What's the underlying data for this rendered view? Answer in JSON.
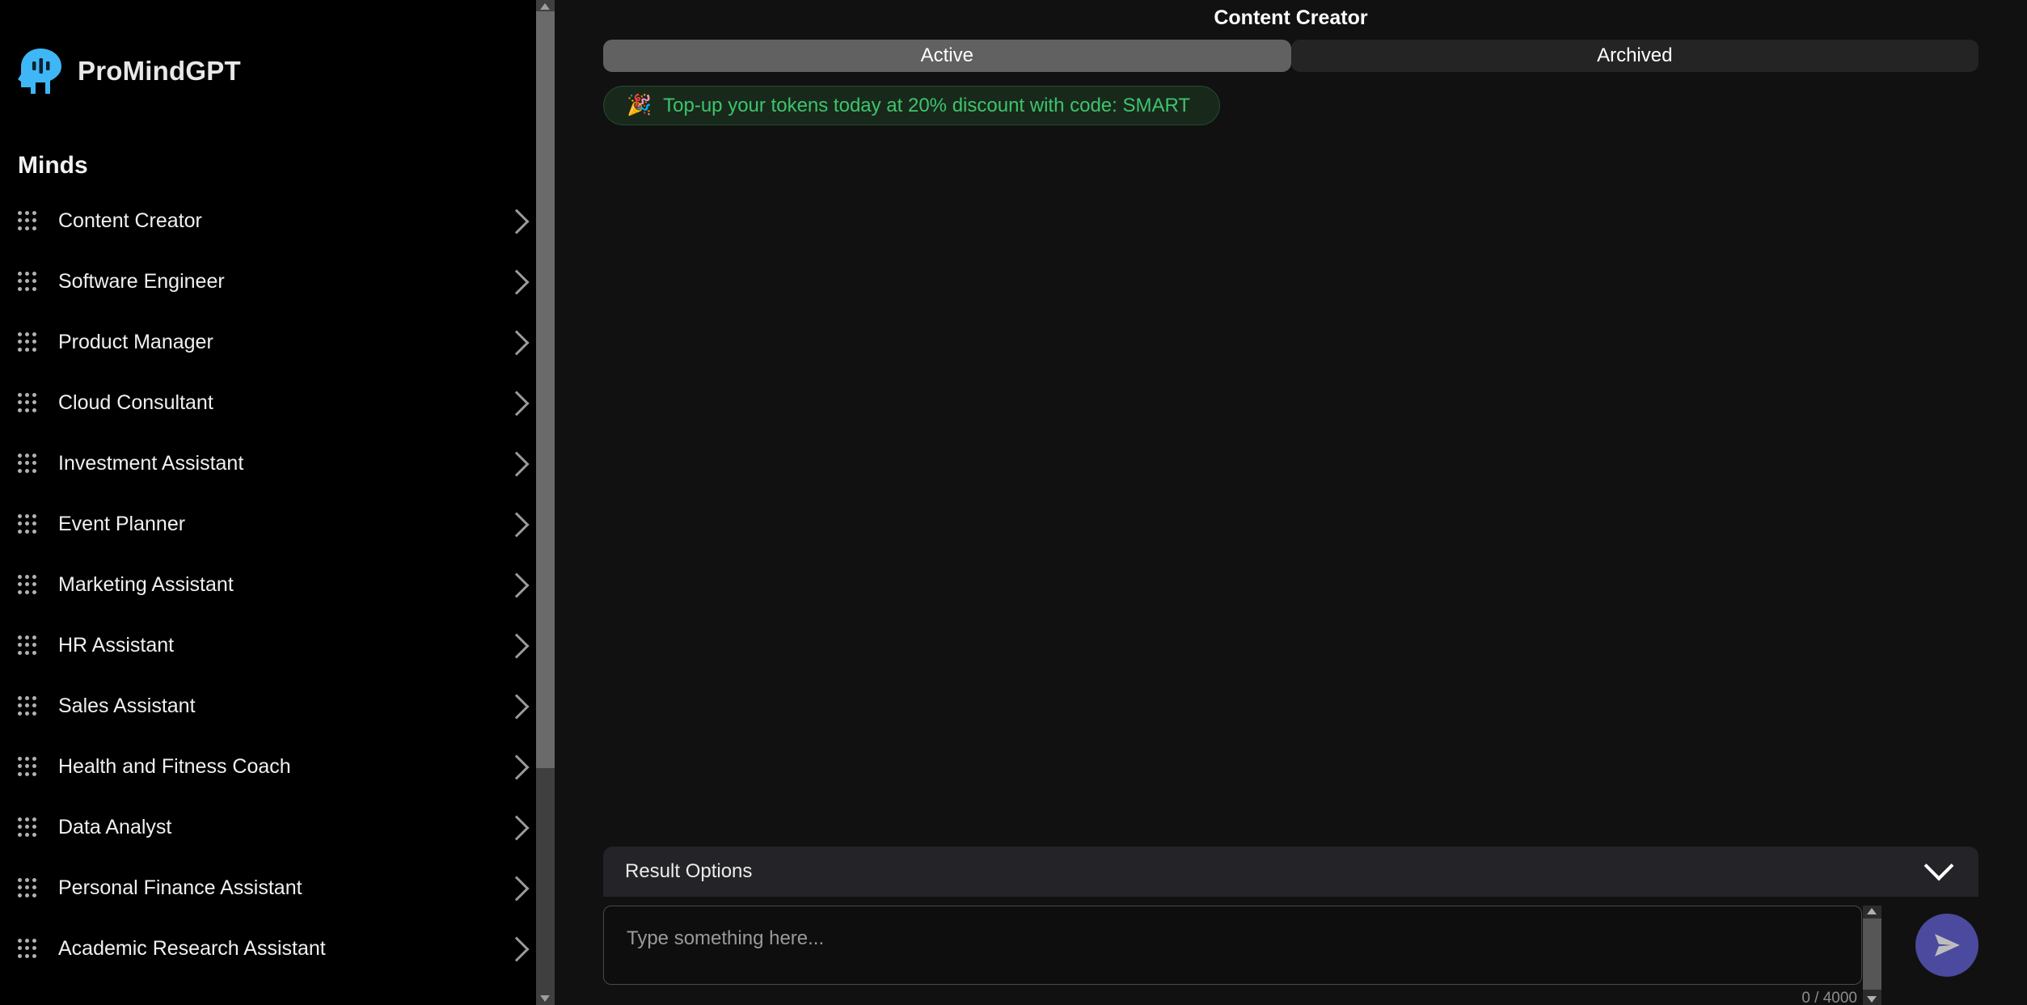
{
  "brand": {
    "name": "ProMindGPT",
    "logo_icon": "head-profile-icon",
    "logo_color": "#3fb6f5"
  },
  "sidebar": {
    "section_title": "Minds",
    "drag_handle_icon": "drag-grid-icon",
    "chevron_icon": "chevron-right-icon",
    "items": [
      {
        "label": "Content Creator"
      },
      {
        "label": "Software Engineer"
      },
      {
        "label": "Product Manager"
      },
      {
        "label": "Cloud Consultant"
      },
      {
        "label": "Investment Assistant"
      },
      {
        "label": "Event Planner"
      },
      {
        "label": "Marketing Assistant"
      },
      {
        "label": "HR Assistant"
      },
      {
        "label": "Sales Assistant"
      },
      {
        "label": "Health and Fitness Coach"
      },
      {
        "label": "Data Analyst"
      },
      {
        "label": "Personal Finance Assistant"
      },
      {
        "label": "Academic Research Assistant"
      }
    ]
  },
  "header": {
    "title": "Content Creator"
  },
  "tabs": [
    {
      "label": "Active",
      "selected": true
    },
    {
      "label": "Archived",
      "selected": false
    }
  ],
  "promo": {
    "icon": "party-popper-icon",
    "emoji": "🎉",
    "text": "Top-up your tokens today at 20% discount with code: SMART",
    "text_color": "#3ec46b"
  },
  "composer": {
    "result_options_label": "Result Options",
    "chevron_icon": "chevron-down-icon",
    "input_placeholder": "Type something here...",
    "input_value": "",
    "char_counter": "0 / 4000",
    "send_icon": "send-paper-plane-icon",
    "send_button_color": "#4c4a9e"
  }
}
